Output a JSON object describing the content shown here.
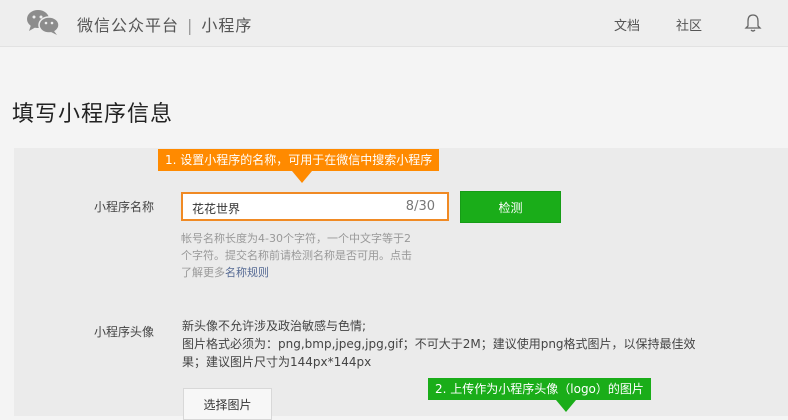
{
  "header": {
    "brand": "微信公众平台",
    "separator": "|",
    "section": "小程序",
    "nav_docs": "文档",
    "nav_community": "社区"
  },
  "page_title": "填写小程序信息",
  "callouts": {
    "name_tip": "1. 设置小程序的名称，可用于在微信中搜索小程序",
    "avatar_tip": "2. 上传作为小程序头像（logo）的图片"
  },
  "form": {
    "name_label": "小程序名称",
    "name_value": "花花世界",
    "name_count": "8/30",
    "check_button": "检测",
    "name_hint_line1": "帐号名称长度为4-30个字符，一个中文字等于2",
    "name_hint_line2": "个字符。提交名称前请检测名称是否可用。点击",
    "name_hint_prefix": "了解更多",
    "name_hint_link": "名称规则",
    "avatar_label": "小程序头像",
    "avatar_desc_line1": "新头像不允许涉及政治敏感与色情;",
    "avatar_desc_line2": "图片格式必须为：png,bmp,jpeg,jpg,gif；不可大于2M；建议使用png格式图片，以保持最佳效",
    "avatar_desc_line3": "果；建议图片尺寸为144px*144px",
    "select_button": "选择图片"
  },
  "colors": {
    "accent_orange": "#ff8a00",
    "accent_green": "#1aad19",
    "link": "#576b95"
  },
  "icons": [
    "wechat-logo-icon",
    "bell-icon"
  ]
}
